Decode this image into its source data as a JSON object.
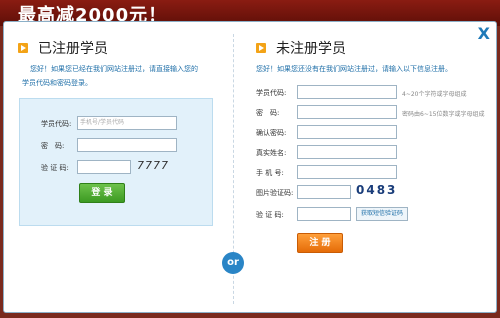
{
  "banner": {
    "text": "最高减2000元！"
  },
  "dialog": {
    "close": "X",
    "or": "or"
  },
  "left": {
    "title": "已注册学员",
    "intro_line1": "您好！如果您已经在我们网站注册过，请直接输入您的",
    "intro_line2": "学员代码和密码登录。",
    "code_label": "学员代码:",
    "code_placeholder": "手机号/学员代码",
    "password_label": "密　码:",
    "verify_label": "验 证 码:",
    "captcha_text": "7777",
    "login_button": "登 录"
  },
  "right": {
    "title": "未注册学员",
    "intro": "您好！如果您还没有在我们网站注册过，请输入以下信息注册。",
    "code_label": "学员代码:",
    "code_hint": "4~20个字符或字母组成",
    "password_label": "密　码:",
    "password_hint": "密码由6~15位数字或字母组成",
    "confirm_label": "确认密码:",
    "name_label": "真实姓名:",
    "phone_label": "手 机 号:",
    "image_captcha_label": "图片验证码:",
    "captcha_image": "0483",
    "sms_label": "验 证 码:",
    "sms_button": "获取短信验证码",
    "register_button": "注 册"
  }
}
